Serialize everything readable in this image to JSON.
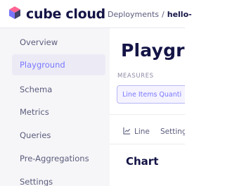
{
  "brand": {
    "name": "cube cloud",
    "colors": {
      "accent": "#7a77ff",
      "text": "#141446"
    }
  },
  "breadcrumb": {
    "parent": "Deployments",
    "separator": "/",
    "current": "hello-"
  },
  "sidebar": {
    "items": [
      {
        "label": "Overview",
        "active": false
      },
      {
        "label": "Playground",
        "active": true
      },
      {
        "label": "Schema",
        "active": false
      },
      {
        "label": "Metrics",
        "active": false
      },
      {
        "label": "Queries",
        "active": false
      },
      {
        "label": "Pre-Aggregations",
        "active": false
      },
      {
        "label": "Settings",
        "active": false
      }
    ]
  },
  "main": {
    "title": "Playgro",
    "measures_label": "MEASURES",
    "measure_pill": "Line Items Quanti",
    "chart_type": {
      "icon": "line-chart-icon",
      "label": "Line"
    },
    "settings_tab": "Settings",
    "card_title": "Chart"
  }
}
